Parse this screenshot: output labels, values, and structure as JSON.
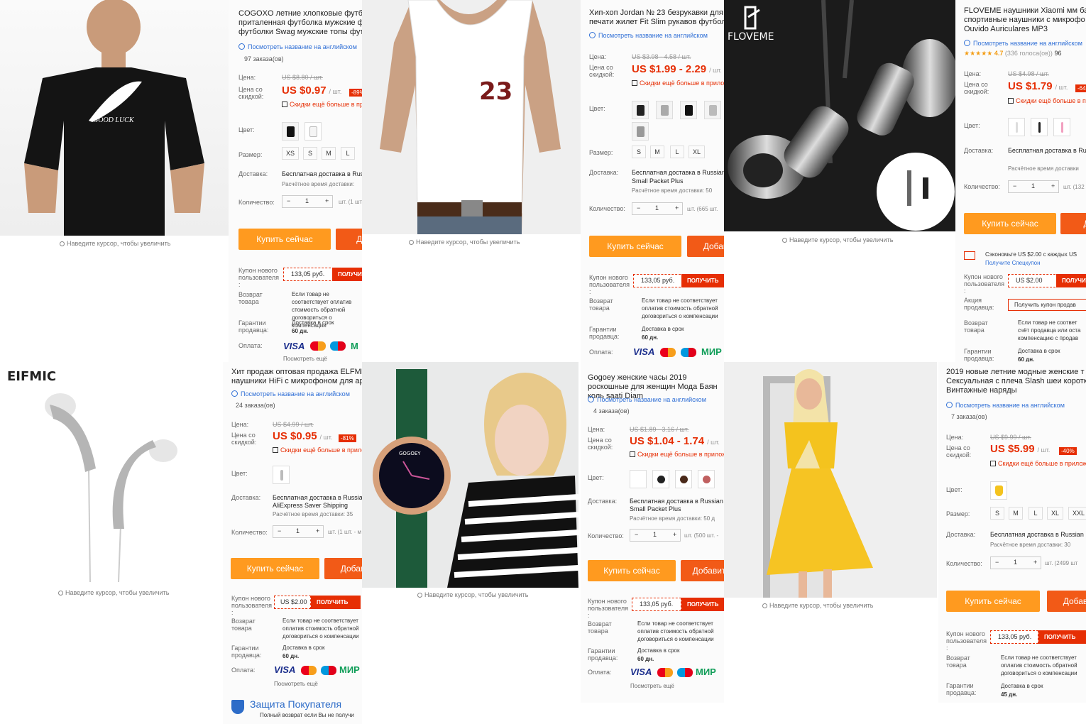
{
  "common": {
    "zoom_hint": "Наведите курсор, чтобы увеличить",
    "translate": "Посмотреть название на английском",
    "price_label": "Цена:",
    "discount_label": "Цена со скидкой:",
    "color_label": "Цвет:",
    "size_label": "Размер:",
    "delivery_label": "Доставка:",
    "quantity_label": "Количество:",
    "buy_now": "Купить сейчас",
    "get": "ПОЛУЧИТЬ",
    "new_user_coupon": "Купон нового пользователя :",
    "return_label": "Возврат товара",
    "guarantee_label": "Гарантии продавца:",
    "payment_label": "Оплата:",
    "see_more": "Посмотреть ещё",
    "app_discount": "Скидки ещё больше в прилож",
    "per_unit": "/ шт.",
    "estimated_delivery": "Расчётное время доставки:",
    "return_text": "Если товар не соответствует оплатив стоимость обратной договориться о компенсации",
    "guarantee_text": "Доставка в срок",
    "free_shipping": "Бесплатная доставка в Russian",
    "small_packet": "Small Packet Plus",
    "pay_visa": "VISA",
    "pay_mir": "МИР"
  },
  "products": [
    {
      "title": "COGOXO летние хлопковые футбо приталенная футболка мужские ф футболки Swag мужские топы футб",
      "orders": "97 заказа(ов)",
      "old_price": "US $8.80 / шт.",
      "price": "US $0.97",
      "discount": "-89%",
      "sizes": [
        "XS",
        "S",
        "M",
        "L"
      ],
      "ship_time": "Расчётное время доставки:",
      "qty": "1",
      "qty_note": "шт. (1 шт",
      "add": "Доб",
      "coupon": "133,05 руб.",
      "guarantee_days": "60 дн.",
      "image_text": "GOOD LUCK"
    },
    {
      "title": "Хип-хоп Jordan № 23 безрукавки для печати жилет Fit Slim рукавов футбол",
      "old_price": "US $3.98 - 4.58 / шт.",
      "price": "US $1.99 - 2.29",
      "sizes": [
        "S",
        "M",
        "L",
        "XL"
      ],
      "ship_time": "Расчётное время доставки: 50",
      "qty": "1",
      "qty_note": "шт. (665 шт.",
      "add": "Добав",
      "coupon": "133,05 руб.",
      "guarantee_days": "60 дн.",
      "image_text": "23"
    },
    {
      "title": "FLOVEME наушники Xiaomi мм ба спортивные наушники с микрофо Ouvido Auriculares MP3",
      "rating": "4.7",
      "votes": "(336 голоса(ов))",
      "votes_extra": "96",
      "old_price": "US $4.98 / шт.",
      "price": "US $1.79",
      "discount": "-64",
      "ship": "Бесплатная доставка в Ru",
      "ship_time": "Расчётное время доставки",
      "qty": "1",
      "qty_note": "шт. (132",
      "add": "До",
      "save": "Сэкономьте US $2.00 с каждых US",
      "spec": "Получите Спецкупон",
      "coupon": "US $2.00",
      "promo_label": "Акция продавца:",
      "promo": "Получить купон продав",
      "return_text": "Если товар не соответ счёт продавца или оста компенсацию с продав",
      "guarantee_days": "60 дн.",
      "brand": "FLOVEME"
    },
    {
      "title": "Хит продаж оптовая продажа ELFMIC наушники HiFi с микрофоном для ap",
      "orders": "24 заказа(ов)",
      "old_price": "US $4.99 / шт.",
      "price": "US $0.95",
      "discount": "-81%",
      "ship": "Бесплатная доставка в Russia",
      "ship2": "AliExpress Saver Shipping",
      "ship_time": "Расчётное время доставки: 35",
      "qty": "1",
      "qty_note": "шт. (1 шт. - м",
      "add": "Добав",
      "coupon": "US $2.00",
      "guarantee_days": "60 дн.",
      "protect": "Защита Покупателя",
      "protect2": "Полный возврат если Вы не получи",
      "brand": "EIFMIC"
    },
    {
      "title": "Gogoey женские часы 2019 роскошные для женщин Мода Баян коль saati Diam",
      "orders": "4 заказа(ов)",
      "old_price": "US $1.89 - 3.16 / шт.",
      "price": "US $1.04 - 1.74",
      "ship": "Бесплатная доставка в Russian",
      "ship_time": "Расчётное время доставки: 50 д",
      "qty": "1",
      "qty_note": "шт. (500 шт. -",
      "add": "Добавит",
      "coupon": "133,05 руб.",
      "guarantee_days": "60 дн.",
      "brand": "GOGOEY"
    },
    {
      "title": "2019 новые летние модные женские т Сексуальная с плеча Slash шеи коротк Винтажные наряды",
      "orders": "7 заказа(ов)",
      "old_price": "US $9.99 / шт.",
      "price": "US $5.99",
      "discount": "-40%",
      "sizes": [
        "S",
        "M",
        "L",
        "XL",
        "XXL"
      ],
      "ship": "Бесплатная доставка в Russian",
      "ship_time": "Расчётное время доставки: 30",
      "qty": "1",
      "qty_note": "шт. (2499 шт",
      "add": "Добав",
      "coupon": "133,05 руб.",
      "guarantee_days": "45 дн."
    }
  ],
  "colors": {
    "accent": "#e62e04",
    "buy": "#ff9a1f",
    "add": "#f25a17",
    "link": "#2f6fd6"
  }
}
